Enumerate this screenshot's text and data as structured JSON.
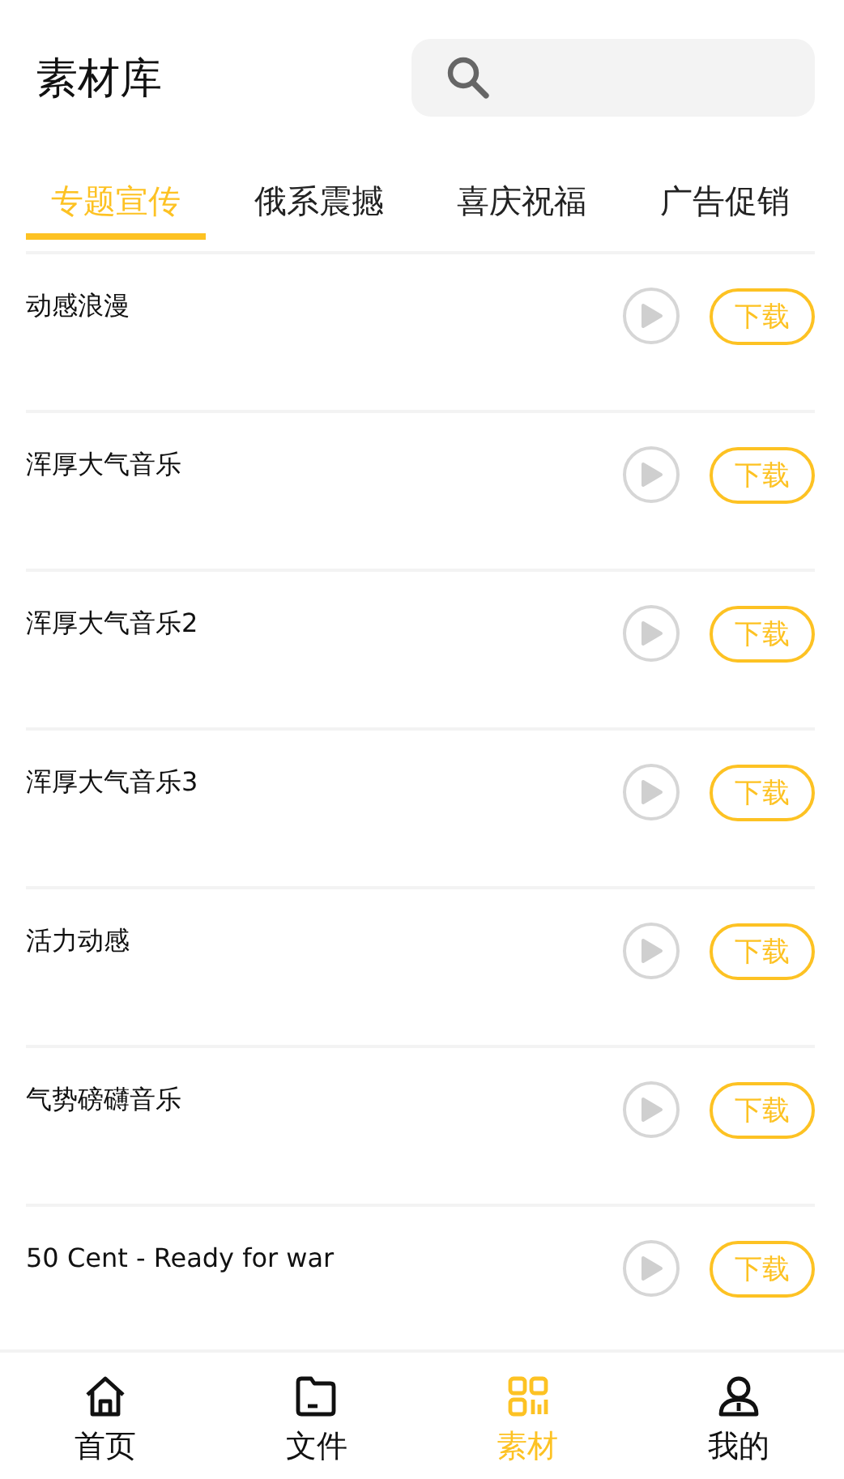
{
  "header": {
    "title": "素材库"
  },
  "tabs": [
    {
      "label": "专题宣传",
      "selected": true
    },
    {
      "label": "俄系震撼",
      "selected": false
    },
    {
      "label": "喜庆祝福",
      "selected": false
    },
    {
      "label": "广告促销",
      "selected": false
    }
  ],
  "items": [
    {
      "name": "动感浪漫",
      "action": "下载"
    },
    {
      "name": "浑厚大气音乐",
      "action": "下载"
    },
    {
      "name": "浑厚大气音乐2",
      "action": "下载"
    },
    {
      "name": "浑厚大气音乐3",
      "action": "下载"
    },
    {
      "name": "活力动感",
      "action": "下载"
    },
    {
      "name": "气势磅礴音乐",
      "action": "下载"
    },
    {
      "name": "50 Cent - Ready for war",
      "action": "下载"
    }
  ],
  "nav": [
    {
      "label": "首页",
      "selected": false
    },
    {
      "label": "文件",
      "selected": false
    },
    {
      "label": "素材",
      "selected": true
    },
    {
      "label": "我的",
      "selected": false
    }
  ]
}
